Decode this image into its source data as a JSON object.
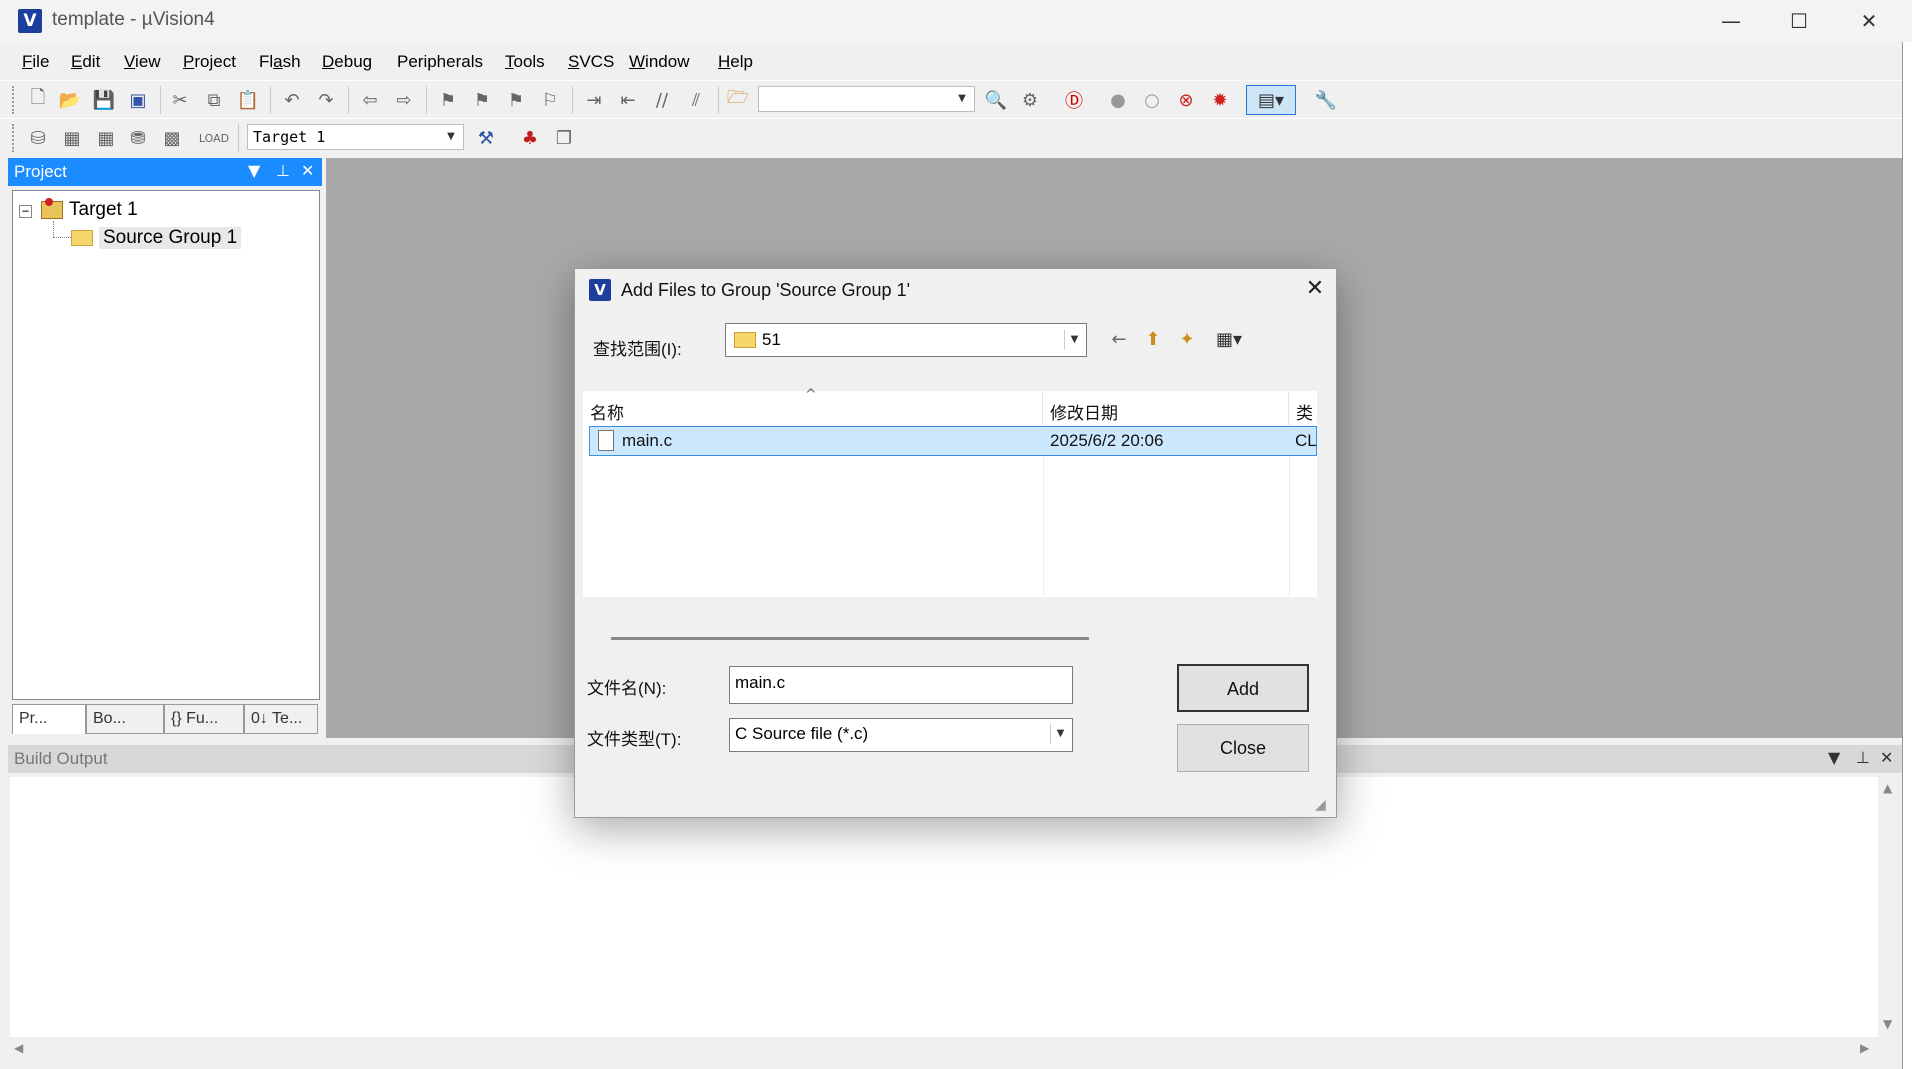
{
  "window": {
    "title": "template  - µVision4",
    "app_icon": "V",
    "minimize": "—",
    "maximize": "☐",
    "close": "✕"
  },
  "menu": [
    {
      "label": "File",
      "key": "F",
      "rest": "ile"
    },
    {
      "label": "Edit",
      "key": "E",
      "rest": "dit"
    },
    {
      "label": "View",
      "key": "V",
      "rest": "iew"
    },
    {
      "label": "Project",
      "key": "P",
      "rest": "roject"
    },
    {
      "label": "Flash",
      "key": "",
      "rest": "Fl",
      "key2": "a",
      "rest2": "sh"
    },
    {
      "label": "Debug",
      "key": "D",
      "rest": "ebug"
    },
    {
      "label": "Peripherals",
      "key": "",
      "rest": "Peripherals"
    },
    {
      "label": "Tools",
      "key": "T",
      "rest": "ools"
    },
    {
      "label": "SVCS",
      "key": "S",
      "rest": "VCS"
    },
    {
      "label": "Window",
      "key": "W",
      "rest": "indow"
    },
    {
      "label": "Help",
      "key": "H",
      "rest": "elp"
    }
  ],
  "toolbar2": {
    "target": "Target 1"
  },
  "project_panel": {
    "title": "Project",
    "dropdown_icon": "▼",
    "pin_icon": "⊥",
    "close_icon": "✕",
    "tree": {
      "target": "Target 1",
      "group": "Source Group 1"
    },
    "tabs": [
      "Pr...",
      "Bo...",
      "{} Fu...",
      "0↓ Te..."
    ]
  },
  "build_output": {
    "title": "Build Output"
  },
  "dialog": {
    "title": "Add Files to Group 'Source Group 1'",
    "close": "✕",
    "look_in_label": "查找范围(I):",
    "look_in_value": "51",
    "columns": {
      "name": "名称",
      "date": "修改日期",
      "type": "类"
    },
    "files": [
      {
        "name": "main.c",
        "date": "2025/6/2 20:06",
        "type": "CL"
      }
    ],
    "file_name_label": "文件名(N):",
    "file_name_value": "main.c",
    "file_type_label": "文件类型(T):",
    "file_type_value": "C Source file (*.c)",
    "add_button": "Add",
    "close_button": "Close"
  }
}
